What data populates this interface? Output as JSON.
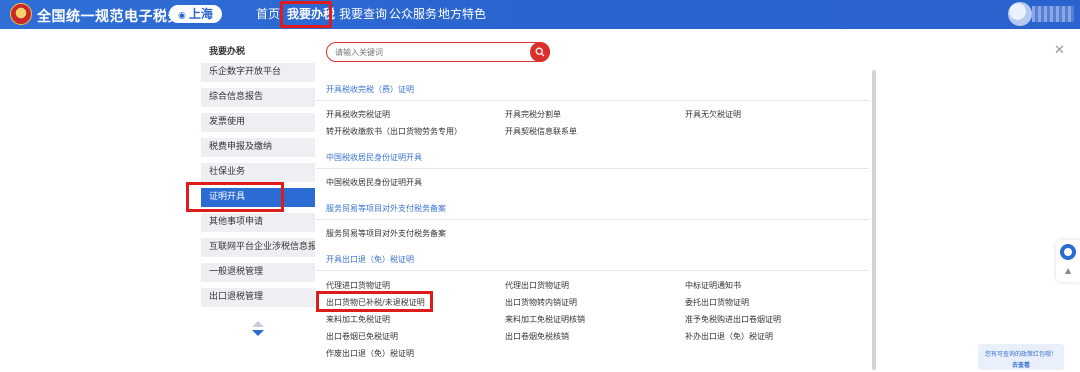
{
  "header": {
    "site_title": "全国统一规范电子税务局",
    "region": "上海",
    "nav": [
      "首页",
      "我要办税",
      "我要查询",
      "公众服务",
      "地方特色"
    ]
  },
  "sidebar": {
    "title": "我要办税",
    "items": [
      "乐企数字开放平台",
      "综合信息报告",
      "发票使用",
      "税费申报及缴纳",
      "社保业务",
      "证明开具",
      "其他事项申请",
      "互联网平台企业涉税信息报送",
      "一般退税管理",
      "出口退税管理"
    ]
  },
  "search": {
    "placeholder": "请输入关键词"
  },
  "sections": [
    {
      "title": "开具税收完税（费）证明",
      "links": [
        "开具税收完税证明",
        "开具完税分割单",
        "开具无欠税证明",
        "转开税收缴款书（出口货物劳务专用）",
        "开具契税信息联系单"
      ]
    },
    {
      "title": "中国税收居民身份证明开具",
      "links": [
        "中国税收居民身份证明开具"
      ]
    },
    {
      "title": "服务贸易等项目对外支付税务备案",
      "links": [
        "服务贸易等项目对外支付税务备案"
      ]
    },
    {
      "title": "开具出口退（免）税证明",
      "links": [
        "代理进口货物证明",
        "代理出口货物证明",
        "中标证明通知书",
        "出口货物已补税/未退税证明",
        "出口货物转内销证明",
        "委托出口货物证明",
        "来料加工免税证明",
        "来料加工免税证明核销",
        "准予免税购进出口卷烟证明",
        "出口卷烟已免税证明",
        "出口卷烟免税核销",
        "补办出口退（免）税证明",
        "作废出口退（免）税证明"
      ]
    }
  ],
  "promo": {
    "line1": "您有可查询的政策红包哦！",
    "line2": "去查看"
  },
  "colors": {
    "header_blue": "#2a64cf",
    "active_blue": "#2a6bd4",
    "highlight_red": "#e01b1b",
    "section_blue": "#3b73d1"
  }
}
